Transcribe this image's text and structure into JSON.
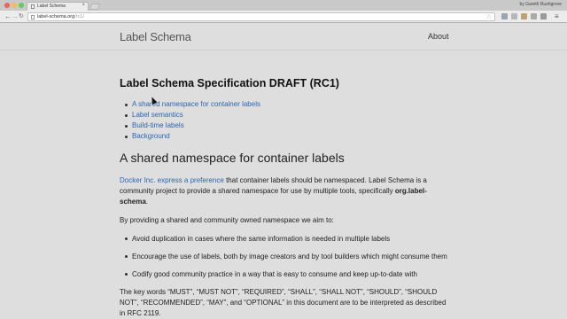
{
  "browser": {
    "tab_title": "Label Schema",
    "tab_close": "×",
    "profile": "by Gareth Rushgrove",
    "url_host": "label-schema.org",
    "url_path": "/rc1/",
    "nav_back": "←",
    "nav_forward": "→",
    "nav_reload": "↻",
    "star": "☆",
    "menu": "≡"
  },
  "site": {
    "brand": "Label Schema",
    "about": "About"
  },
  "content": {
    "title": "Label Schema Specification DRAFT (RC1)",
    "toc": [
      "A shared namespace for container labels",
      "Label semantics",
      "Build-time labels",
      "Background"
    ],
    "section_heading": "A shared namespace for container labels",
    "p1_link": "Docker Inc. express a preference",
    "p1_text": " that container labels should be namespaced. Label Schema is a community project to provide a shared namespace for use by multiple tools, specifically ",
    "p1_bold": "org.label-schema",
    "p1_end": ".",
    "p2": "By providing a shared and community owned namespace we aim to:",
    "bullets": [
      "Avoid duplication in cases where the same information is needed in multiple labels",
      "Encourage the use of labels, both by image creators and by tool builders which might consume them",
      "Codify good community practice in a way that is easy to consume and keep up-to-date with"
    ],
    "p3": "The key words “MUST”, “MUST NOT”, “REQUIRED”, “SHALL”, “SHALL NOT”, “SHOULD”, “SHOULD NOT”, “RECOMMENDED”, “MAY”, and “OPTIONAL” in this document are to be interpreted as described in RFC 2119."
  }
}
